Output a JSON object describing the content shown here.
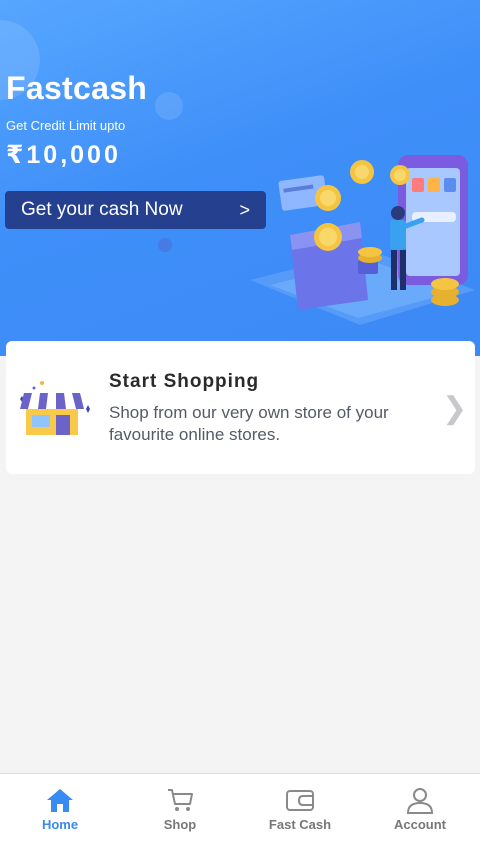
{
  "hero": {
    "title": "Fastcash",
    "subtitle": "Get Credit Limit upto",
    "amount": "₹10,000",
    "cta_label": "Get your cash Now",
    "cta_icon": "chevron-right-icon"
  },
  "shop_card": {
    "title": "Start Shopping",
    "description": "Shop from our very own store of your favourite online stores.",
    "icon": "store-icon"
  },
  "bottom_nav": {
    "items": [
      {
        "label": "Home",
        "icon": "home-icon",
        "active": true
      },
      {
        "label": "Shop",
        "icon": "cart-icon",
        "active": false
      },
      {
        "label": "Fast Cash",
        "icon": "wallet-icon",
        "active": false
      },
      {
        "label": "Account",
        "icon": "user-icon",
        "active": false
      }
    ]
  },
  "colors": {
    "hero_bg": "#3f8ff9",
    "cta_bg": "#24408f",
    "active_nav": "#3a8af3",
    "page_bg": "#f4f4f5"
  }
}
